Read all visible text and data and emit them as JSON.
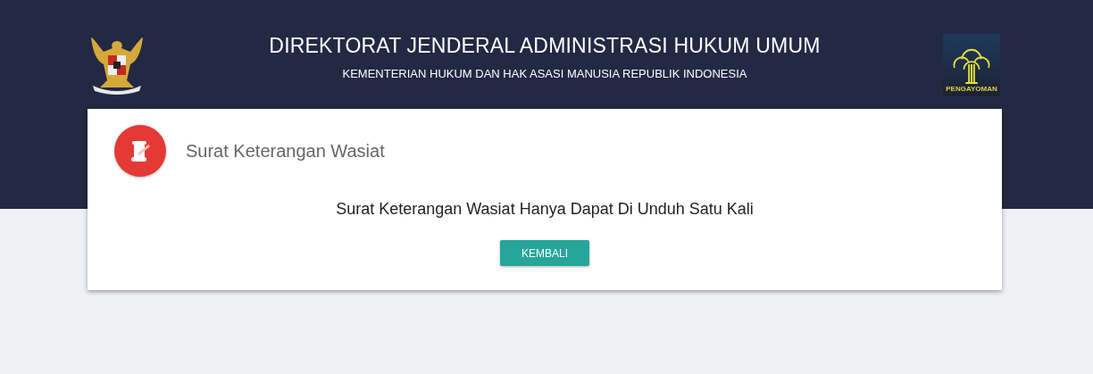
{
  "header": {
    "title": "DIREKTORAT JENDERAL ADMINISTRASI HUKUM UMUM",
    "subtitle": "KEMENTERIAN HUKUM DAN HAK ASASI MANUSIA REPUBLIK INDONESIA",
    "right_logo": {
      "caption": "PENGAYOMAN"
    }
  },
  "card": {
    "title": "Surat Keterangan Wasiat",
    "message": "Surat Keterangan Wasiat Hanya Dapat Di Unduh Satu Kali",
    "button": "KEMBALI"
  }
}
